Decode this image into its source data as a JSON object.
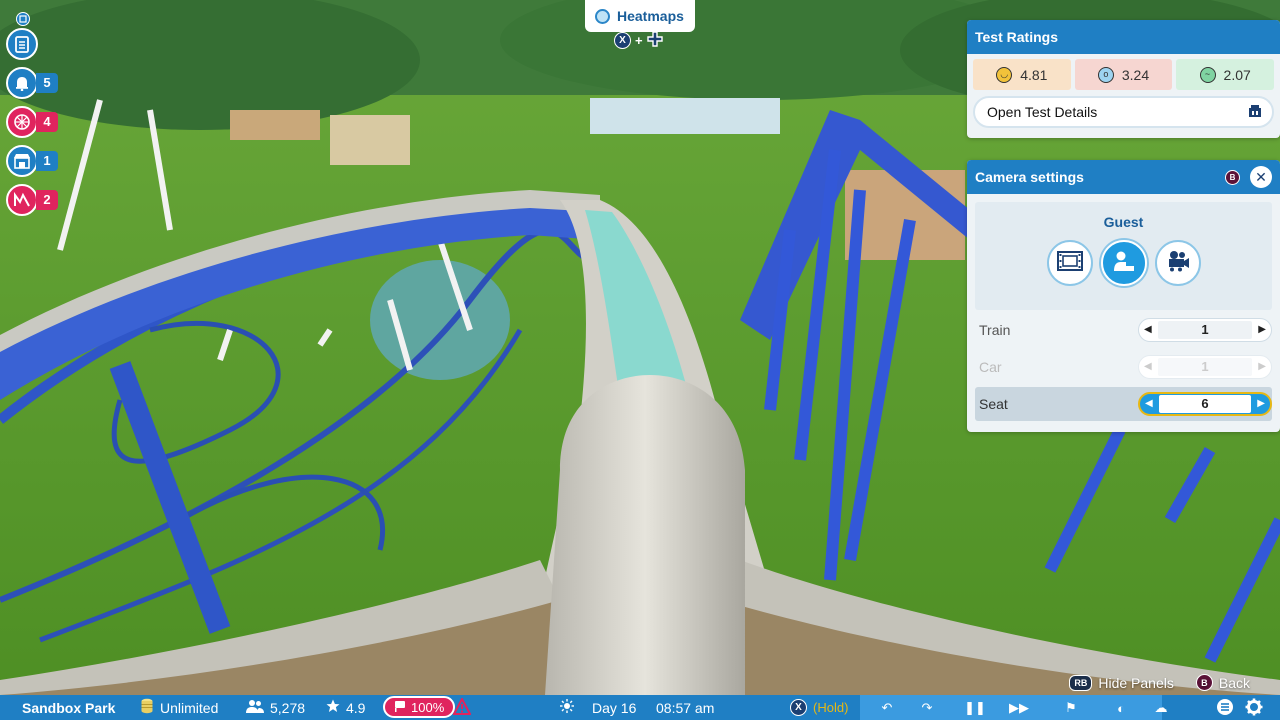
{
  "heatmaps": {
    "label": "Heatmaps",
    "hint_plus": "+"
  },
  "notifications": [
    {
      "icon": "clipboard-icon",
      "count": ""
    },
    {
      "icon": "bell-icon",
      "count": "5"
    },
    {
      "icon": "coaster-alert-icon",
      "count": "4"
    },
    {
      "icon": "shop-icon",
      "count": "1"
    },
    {
      "icon": "staff-alert-icon",
      "count": "2"
    }
  ],
  "test_ratings": {
    "title": "Test Ratings",
    "excitement": "4.81",
    "intensity": "3.24",
    "nausea": "2.07",
    "open_details": "Open Test Details",
    "colors": {
      "excitement": "#f9e2c8",
      "intensity": "#f6d6d1",
      "nausea": "#d5f1df"
    }
  },
  "camera_settings": {
    "title": "Camera settings",
    "mode_label": "Guest",
    "rows": [
      {
        "label": "Train",
        "value": "1"
      },
      {
        "label": "Car",
        "value": "1"
      },
      {
        "label": "Seat",
        "value": "6"
      }
    ]
  },
  "hints": {
    "hide_panels": "Hide Panels",
    "back": "Back",
    "rb": "RB",
    "b": "B"
  },
  "bottombar": {
    "park_name": "Sandbox Park",
    "money": "Unlimited",
    "guests": "5,278",
    "rating": "4.9",
    "research": "100%",
    "day": "Day 16",
    "time": "08:57 am",
    "hold": "(Hold)"
  }
}
